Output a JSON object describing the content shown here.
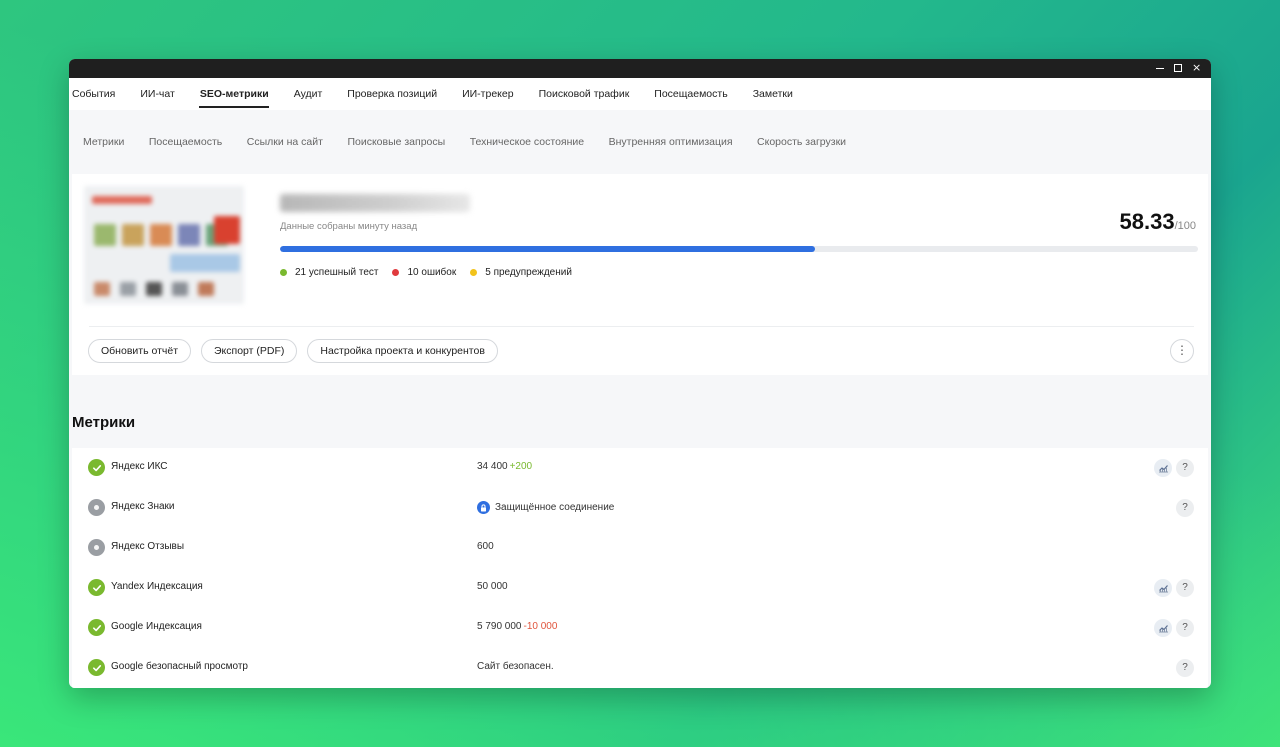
{
  "window": {
    "controls": {
      "minimize": "minimize-icon",
      "maximize": "maximize-icon",
      "close": "×"
    }
  },
  "top_tabs": [
    {
      "label": "События",
      "active": false
    },
    {
      "label": "ИИ-чат",
      "active": false
    },
    {
      "label": "SEO-метрики",
      "active": true
    },
    {
      "label": "Аудит",
      "active": false
    },
    {
      "label": "Проверка позиций",
      "active": false
    },
    {
      "label": "ИИ-трекер",
      "active": false
    },
    {
      "label": "Поисковой трафик",
      "active": false
    },
    {
      "label": "Посещаемость",
      "active": false
    },
    {
      "label": "Заметки",
      "active": false
    }
  ],
  "sub_tabs": [
    "Метрики",
    "Посещаемость",
    "Ссылки на сайт",
    "Поисковые запросы",
    "Техническое состояние",
    "Внутренняя оптимизация",
    "Скорость загрузки"
  ],
  "report": {
    "collected": "Данные собраны минуту назад",
    "score": "58.33",
    "score_max": "/100",
    "progress_fraction": 0.5833,
    "legend": [
      {
        "label": "21 успешный тест",
        "color": "#7ab92f"
      },
      {
        "label": "10 ошибок",
        "color": "#e03a3e"
      },
      {
        "label": "5 предупреждений",
        "color": "#f2c31b"
      }
    ],
    "buttons": {
      "refresh": "Обновить отчёт",
      "export": "Экспорт (PDF)",
      "settings": "Настройка проекта и конкурентов"
    },
    "more_icon": "⋮"
  },
  "metrics": {
    "title": "Метрики",
    "rows": [
      {
        "name": "Яндекс ИКС",
        "value": "34 400",
        "delta": "+200",
        "delta_type": "pos",
        "status": "ok",
        "chart": true
      },
      {
        "name": "Яндекс Знаки",
        "value": "Защищённое соединение",
        "delta": "",
        "delta_type": "",
        "status": "neutral",
        "chart": false,
        "badge": "lock-icon"
      },
      {
        "name": "Яндекс Отзывы",
        "value": "600",
        "delta": "",
        "delta_type": "",
        "status": "neutral",
        "chart": false,
        "no_help": true
      },
      {
        "name": "Yandex Индексация",
        "value": "50 000",
        "delta": "",
        "delta_type": "",
        "status": "ok",
        "chart": true
      },
      {
        "name": "Google Индексация",
        "value": "5 790 000",
        "delta": "-10 000",
        "delta_type": "neg",
        "status": "ok",
        "chart": true
      },
      {
        "name": "Google безопасный просмотр",
        "value": "Сайт безопасен.",
        "delta": "",
        "delta_type": "",
        "status": "ok",
        "chart": false
      }
    ],
    "help_label": "?"
  },
  "colors": {
    "accent": "#2f6fe0",
    "success": "#7ab92f",
    "error": "#e03a3e",
    "warning": "#f2c31b"
  }
}
